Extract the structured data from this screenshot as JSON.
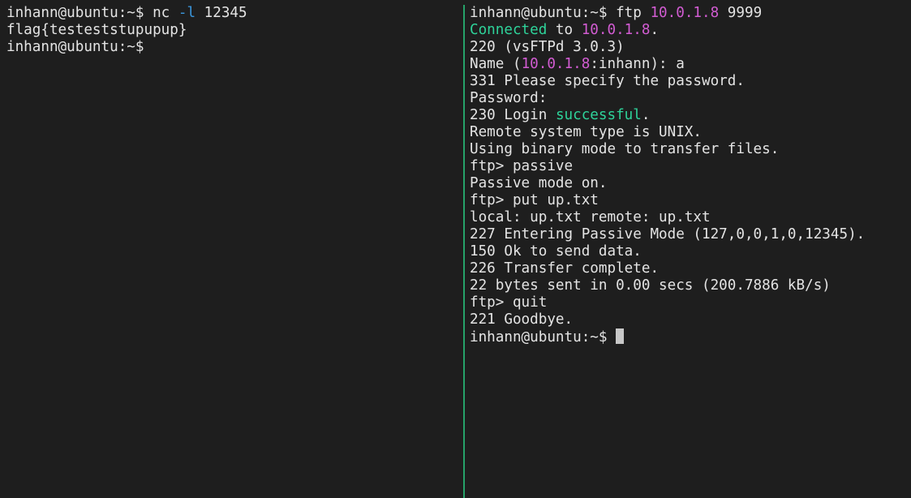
{
  "left_pane": [
    [
      {
        "t": "inhann@ubuntu:~$ nc "
      },
      {
        "t": "-l",
        "c": "c-opt"
      },
      {
        "t": " 12345"
      }
    ],
    [
      {
        "t": "flag{testeststupupup}"
      }
    ],
    [
      {
        "t": "inhann@ubuntu:~$"
      }
    ]
  ],
  "right_pane": [
    [
      {
        "t": "inhann@ubuntu:~$ ftp "
      },
      {
        "t": "10.0.1.8",
        "c": "c-ip"
      },
      {
        "t": " 9999"
      }
    ],
    [
      {
        "t": "Connected",
        "c": "c-green"
      },
      {
        "t": " to "
      },
      {
        "t": "10.0.1.8",
        "c": "c-ip"
      },
      {
        "t": "."
      }
    ],
    [
      {
        "t": "220 (vsFTPd 3.0.3)"
      }
    ],
    [
      {
        "t": "Name ("
      },
      {
        "t": "10.0.1.8",
        "c": "c-ip"
      },
      {
        "t": ":inhann): a"
      }
    ],
    [
      {
        "t": "331 Please specify the password."
      }
    ],
    [
      {
        "t": "Password:"
      }
    ],
    [
      {
        "t": "230 Login "
      },
      {
        "t": "successful",
        "c": "c-green"
      },
      {
        "t": "."
      }
    ],
    [
      {
        "t": "Remote system type is UNIX."
      }
    ],
    [
      {
        "t": "Using binary mode to transfer files."
      }
    ],
    [
      {
        "t": "ftp> passive"
      }
    ],
    [
      {
        "t": "Passive mode on."
      }
    ],
    [
      {
        "t": "ftp> put up.txt"
      }
    ],
    [
      {
        "t": "local: up.txt remote: up.txt"
      }
    ],
    [
      {
        "t": "227 Entering Passive Mode (127,0,0,1,0,12345)."
      }
    ],
    [
      {
        "t": "150 Ok to send data."
      }
    ],
    [
      {
        "t": "226 Transfer complete."
      }
    ],
    [
      {
        "t": "22 bytes sent in 0.00 secs (200.7886 kB/s)"
      }
    ],
    [
      {
        "t": "ftp> quit"
      }
    ],
    [
      {
        "t": "221 Goodbye."
      }
    ],
    [
      {
        "t": "inhann@ubuntu:~$ "
      }
    ]
  ],
  "colors": {
    "background": "#1e1e1e",
    "foreground": "#e4e4e4",
    "ip_address": "#d25cd2",
    "success": "#2ed39a",
    "option_flag": "#3a96dd",
    "pane_divider": "#26a269"
  }
}
